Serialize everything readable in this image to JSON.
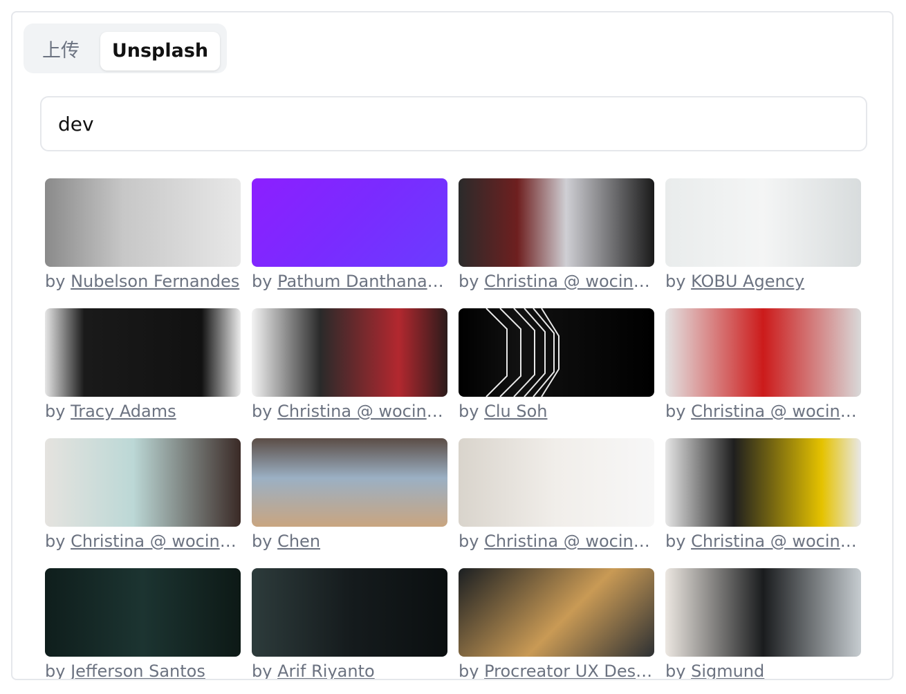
{
  "tabs": [
    {
      "label": "上传"
    },
    {
      "label": "Unsplash",
      "active": true
    }
  ],
  "search": {
    "value": "dev"
  },
  "photos": [
    {
      "by": "by",
      "author": "Nubelson Fernandes"
    },
    {
      "by": "by",
      "author": "Pathum Danthanarayana"
    },
    {
      "by": "by",
      "author": "Christina @ wocintechchat.com"
    },
    {
      "by": "by",
      "author": "KOBU Agency"
    },
    {
      "by": "by",
      "author": "Tracy Adams"
    },
    {
      "by": "by",
      "author": "Christina @ wocintechchat.com"
    },
    {
      "by": "by",
      "author": "Clu Soh"
    },
    {
      "by": "by",
      "author": "Christina @ wocintechchat.com"
    },
    {
      "by": "by",
      "author": "Christina @ wocintechchat.com"
    },
    {
      "by": "by",
      "author": "Chen"
    },
    {
      "by": "by",
      "author": "Christina @ wocintechchat.com"
    },
    {
      "by": "by",
      "author": "Christina @ wocintechchat.com"
    },
    {
      "by": "by",
      "author": "Jefferson Santos"
    },
    {
      "by": "by",
      "author": "Arif Riyanto"
    },
    {
      "by": "by",
      "author": "Procreator UX Design Studio"
    },
    {
      "by": "by",
      "author": "Sigmund"
    }
  ]
}
